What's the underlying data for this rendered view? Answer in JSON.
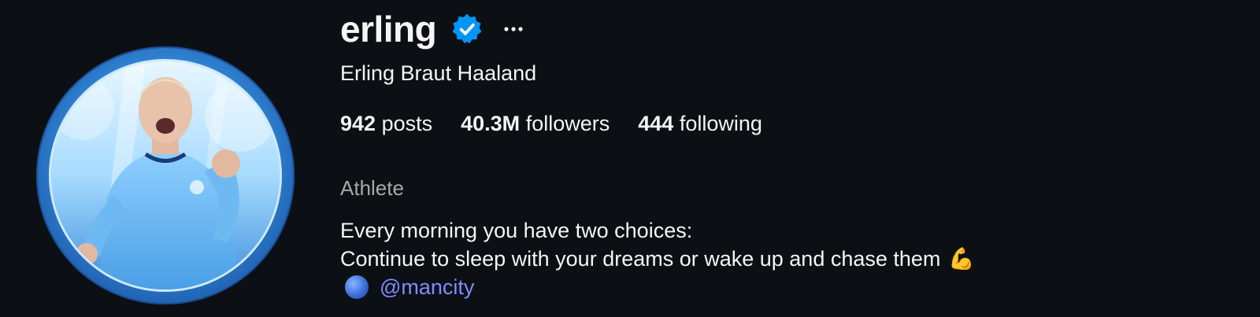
{
  "profile": {
    "username": "erling",
    "full_name": "Erling Braut Haaland",
    "verified": true,
    "stats": {
      "posts_count": "942",
      "posts_label": "posts",
      "followers_count": "40.3M",
      "followers_label": "followers",
      "following_count": "444",
      "following_label": "following"
    },
    "category": "Athlete",
    "bio_line1": "Every morning you have two choices:",
    "bio_line2": "Continue to sleep with your dreams or wake up and chase them",
    "bio_emoji": "💪",
    "mention": "@mancity"
  },
  "colors": {
    "background": "#0c1014",
    "verified_badge": "#0095f6",
    "mention_link": "#7f8cff",
    "category_text": "#a8a8a8"
  },
  "icons": {
    "verified": "verified-badge-icon",
    "more": "more-options-icon",
    "blue_circle": "blue-circle-emoji-icon",
    "flexed_biceps": "flexed-biceps-emoji-icon"
  }
}
